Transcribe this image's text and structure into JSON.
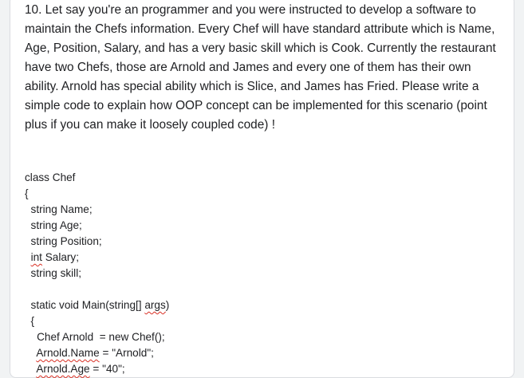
{
  "question": {
    "text": "10. Let say you're an programmer and you were instructed to develop a software to maintain the Chefs information. Every Chef will have standard attribute which is Name, Age, Position, Salary, and has a very basic skill which is Cook. Currently the restaurant have two Chefs, those are Arnold and James and every one of them has their own ability. Arnold has special ability which is Slice, and James has Fried. Please write a simple code to explain how OOP concept can be implemented for this scenario (point plus if you can make it loosely coupled code) !"
  },
  "answer": {
    "lines": [
      [
        {
          "t": "class Chef"
        }
      ],
      [
        {
          "t": "{"
        }
      ],
      [
        {
          "t": "  string Name;"
        }
      ],
      [
        {
          "t": "  string Age;"
        }
      ],
      [
        {
          "t": "  string Position;"
        }
      ],
      [
        {
          "t": "  "
        },
        {
          "t": "int",
          "spell": true
        },
        {
          "t": " Salary;"
        }
      ],
      [
        {
          "t": "  string skill;"
        }
      ],
      [
        {
          "t": ""
        }
      ],
      [
        {
          "t": "  static void Main(string[] "
        },
        {
          "t": "args",
          "spell": true
        },
        {
          "t": ")"
        }
      ],
      [
        {
          "t": "  {"
        }
      ],
      [
        {
          "t": "    Chef Arnold  = new Chef();"
        }
      ],
      [
        {
          "t": "    "
        },
        {
          "t": "Arnold.Name",
          "spell": true
        },
        {
          "t": " = \"Arnold\";"
        }
      ],
      [
        {
          "t": "    "
        },
        {
          "t": "Arnold.Age",
          "spell": true
        },
        {
          "t": " = \"40\";"
        }
      ]
    ]
  }
}
